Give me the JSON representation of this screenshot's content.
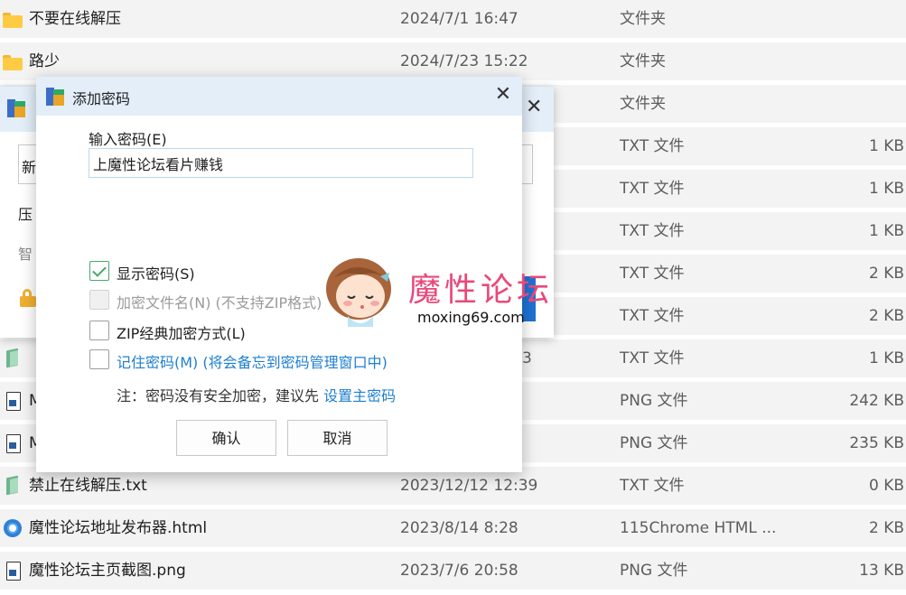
{
  "files": [
    {
      "icon": "folder-icon",
      "name": "不要在线解压",
      "date": "2024/7/1 16:47",
      "type": "文件夹",
      "size": ""
    },
    {
      "icon": "folder-icon",
      "name": "路少",
      "date": "2024/7/23 15:22",
      "type": "文件夹",
      "size": ""
    },
    {
      "icon": "",
      "name": "",
      "date": "",
      "type": "文件夹",
      "size": ""
    },
    {
      "icon": "",
      "name": "",
      "date": "",
      "type": "TXT 文件",
      "size": "1 KB"
    },
    {
      "icon": "",
      "name": "",
      "date": "",
      "type": "TXT 文件",
      "size": "1 KB"
    },
    {
      "icon": "",
      "name": "",
      "date": "",
      "type": "TXT 文件",
      "size": "1 KB"
    },
    {
      "icon": "",
      "name": "",
      "date": "",
      "type": "TXT 文件",
      "size": "2 KB"
    },
    {
      "icon": "",
      "name": "",
      "date": "",
      "type": "TXT 文件",
      "size": "2 KB"
    },
    {
      "icon": "txt-icon",
      "name": "",
      "date": "3",
      "type": "TXT 文件",
      "size": "1 KB"
    },
    {
      "icon": "png-icon",
      "name": "M",
      "date": "",
      "type": "PNG 文件",
      "size": "242 KB"
    },
    {
      "icon": "png-icon",
      "name": "M",
      "date": "",
      "type": "PNG 文件",
      "size": "235 KB"
    },
    {
      "icon": "txt-icon",
      "name": "禁止在线解压.txt",
      "date": "2023/12/12 12:39",
      "type": "TXT 文件",
      "size": "0 KB"
    },
    {
      "icon": "chrome-html-icon",
      "name": "魔性论坛地址发布器.html",
      "date": "2023/8/14 8:28",
      "type": "115Chrome HTML ...",
      "size": "2 KB"
    },
    {
      "icon": "png-icon",
      "name": "魔性论坛主页截图.png",
      "date": "2023/7/6 20:58",
      "type": "PNG 文件",
      "size": "13 KB"
    }
  ],
  "bg_dialog": {
    "field_text": "新",
    "line2": "压",
    "line3": "智"
  },
  "password_dialog": {
    "title": "添加密码",
    "close_glyph": "✕",
    "password_label": "输入密码(E)",
    "password_value": "上魔性论坛看片赚钱",
    "options": [
      {
        "label": "显示密码(S)",
        "checked": true,
        "disabled": false
      },
      {
        "label": "加密文件名(N) (不支持ZIP格式)",
        "checked": false,
        "disabled": true
      },
      {
        "label": "ZIP经典加密方式(L)",
        "checked": false,
        "disabled": false
      },
      {
        "label": "记住密码(M) (将会备忘到密码管理窗口中)",
        "checked": false,
        "disabled": false
      }
    ],
    "note_text": "注：密码没有安全加密，建议先 ",
    "note_link": "设置主密码",
    "ok_label": "确认",
    "cancel_label": "取消"
  },
  "watermark": {
    "brand": "魔性论坛",
    "url": "moxing69.com"
  },
  "colors": {
    "accent": "#1e7fcf",
    "check": "#46a86a",
    "titlebar": "#e3eef9",
    "row_bg": "#f3f3f3",
    "brand": "#e8497a"
  }
}
